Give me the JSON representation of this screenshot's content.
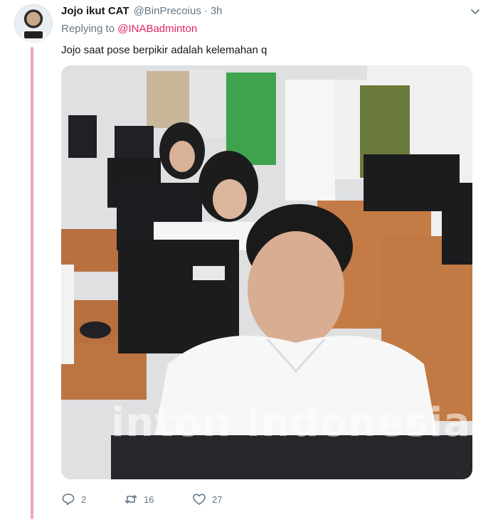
{
  "tweet": {
    "display_name": "Jojo ikut CAT",
    "handle": "@BinPrecoius",
    "separator": "·",
    "timestamp": "3h",
    "replying_prefix": "Replying to",
    "replying_to": "@INABadminton",
    "text": "Jojo saat pose berpikir adalah kelemahan q",
    "media": {
      "watermark": "inton Indonesia"
    }
  },
  "actions": {
    "reply_count": "2",
    "retweet_count": "16",
    "like_count": "27"
  },
  "icons": {
    "menu": "chevron-down-icon",
    "reply": "reply-icon",
    "retweet": "retweet-icon",
    "like": "heart-icon"
  },
  "colors": {
    "link": "#e0245e",
    "thread_line": "#f4a2c1",
    "muted": "#657786"
  }
}
